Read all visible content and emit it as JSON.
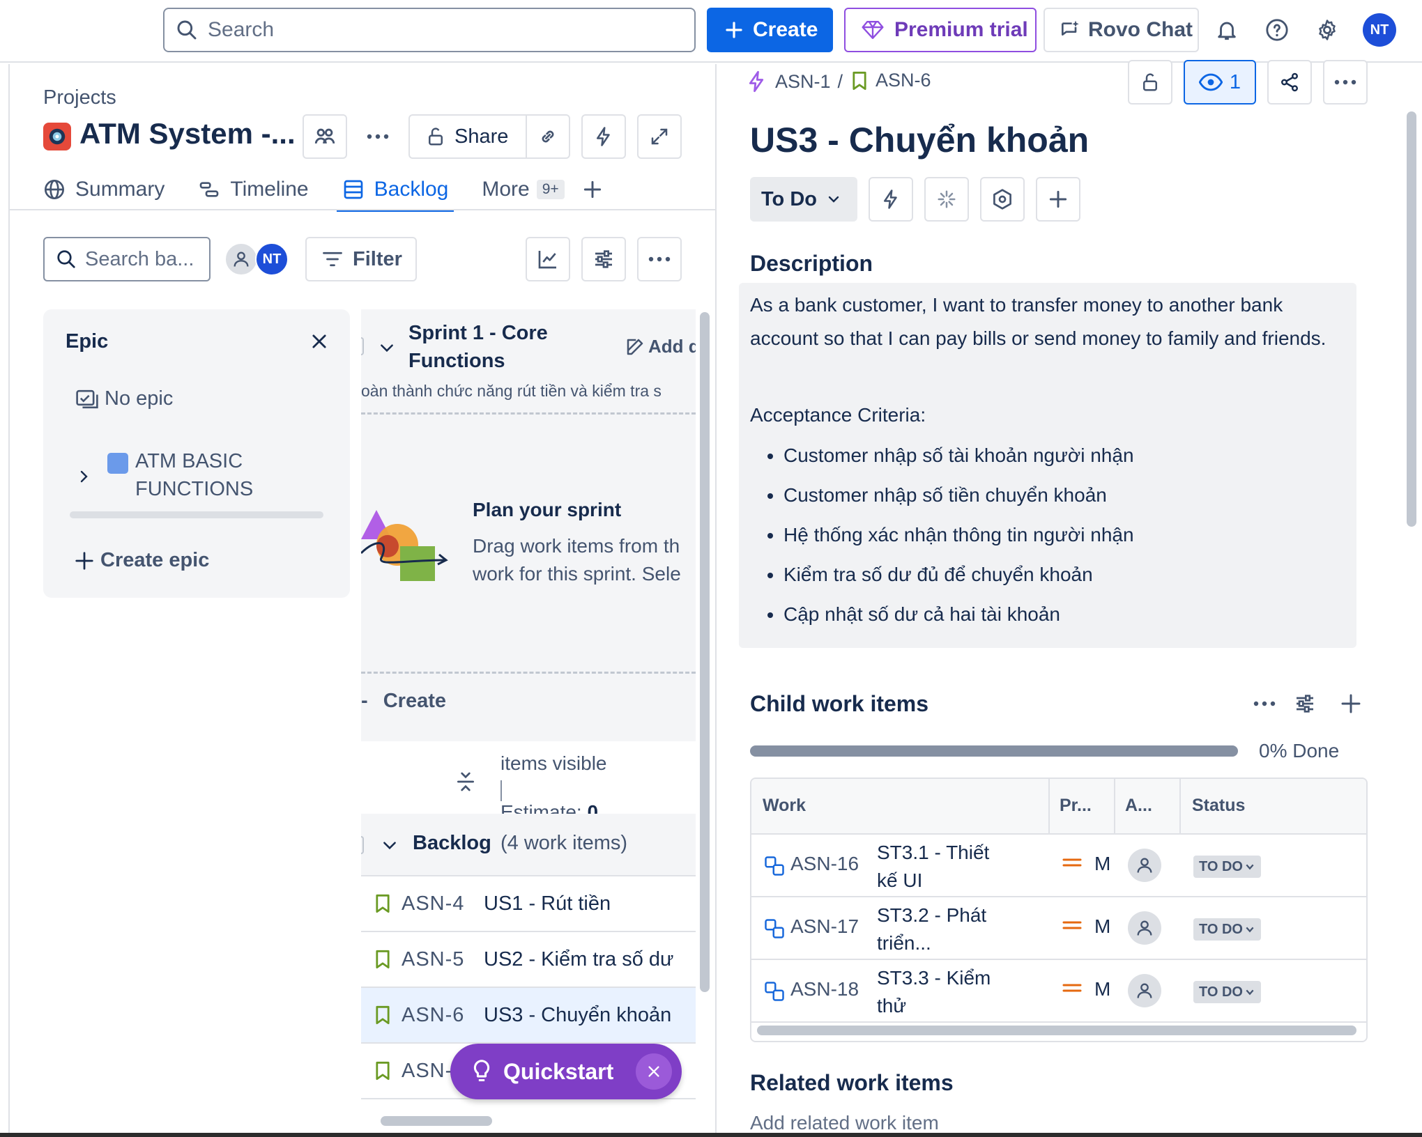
{
  "topbar": {
    "search_placeholder": "Search",
    "create_label": "Create",
    "premium_label": "Premium trial",
    "rovo_label": "Rovo Chat",
    "avatar_initials": "NT",
    "accent_color": "#0c66e4"
  },
  "project": {
    "breadcrumb": "Projects",
    "title": "ATM System -...",
    "share_label": "Share",
    "tabs": [
      {
        "label": "Summary",
        "icon": "globe-icon"
      },
      {
        "label": "Timeline",
        "icon": "timeline-icon"
      },
      {
        "label": "Backlog",
        "icon": "backlog-icon",
        "active": true
      },
      {
        "label": "More",
        "icon": "",
        "badge": "9+"
      }
    ]
  },
  "backlog_toolbar": {
    "search_placeholder": "Search ba...",
    "avatar_initials": "NT",
    "filter_label": "Filter"
  },
  "epic_panel": {
    "title": "Epic",
    "no_epic": "No epic",
    "epic_name": "ATM BASIC FUNCTIONS",
    "create_label": "Create epic"
  },
  "sprint": {
    "name": "Sprint 1 - Core Functions",
    "add_label": "Add d",
    "goal": "oàn thành chức năng rút tiền và kiểm tra s",
    "plan_title": "Plan your sprint",
    "plan_line1": "Drag work items from th",
    "plan_line2": "work for this sprint. Sele",
    "create_label": "Create",
    "items_visible": "items visible",
    "estimate_label": "Estimate:",
    "estimate_value": "0"
  },
  "backlog": {
    "title": "Backlog",
    "count": "(4 work items)",
    "rows": [
      {
        "key": "ASN-4",
        "summary": "US1 - Rút tiền"
      },
      {
        "key": "ASN-5",
        "summary": "US2 - Kiểm tra số dư"
      },
      {
        "key": "ASN-6",
        "summary": "US3 - Chuyển khoản",
        "selected": true
      },
      {
        "key": "ASN-",
        "summary": ""
      }
    ]
  },
  "quickstart": {
    "label": "Quickstart"
  },
  "issue": {
    "parent_key": "ASN-1",
    "separator": "/",
    "key": "ASN-6",
    "watchers": "1",
    "title": "US3 - Chuyển khoản",
    "status": "To Do",
    "description_heading": "Description",
    "description": "As a bank customer, I want to transfer money to another bank account so that I can pay bills or send money to family and friends.",
    "acceptance_label": "Acceptance Criteria:",
    "criteria": [
      "Customer nhập số tài khoản người nhận",
      "Customer nhập số tiền chuyển khoản",
      "Hệ thống xác nhận thông tin người nhận",
      "Kiểm tra số dư đủ để chuyển khoản",
      "Cập nhật số dư cả hai tài khoản"
    ],
    "child_heading": "Child work items",
    "progress_text": "0% Done",
    "progress_done_fraction": 0,
    "child_columns": [
      "Work",
      "Pr...",
      "A...",
      "Status"
    ],
    "children": [
      {
        "key": "ASN-16",
        "name": "ST3.1 - Thiết kế UI",
        "priority": "M",
        "status": "TO DO"
      },
      {
        "key": "ASN-17",
        "name": "ST3.2 - Phát triển...",
        "priority": "M",
        "status": "TO DO"
      },
      {
        "key": "ASN-18",
        "name": "ST3.3 - Kiểm thử",
        "priority": "M",
        "status": "TO DO"
      }
    ],
    "related_heading": "Related work items",
    "add_related": "Add related work item"
  }
}
